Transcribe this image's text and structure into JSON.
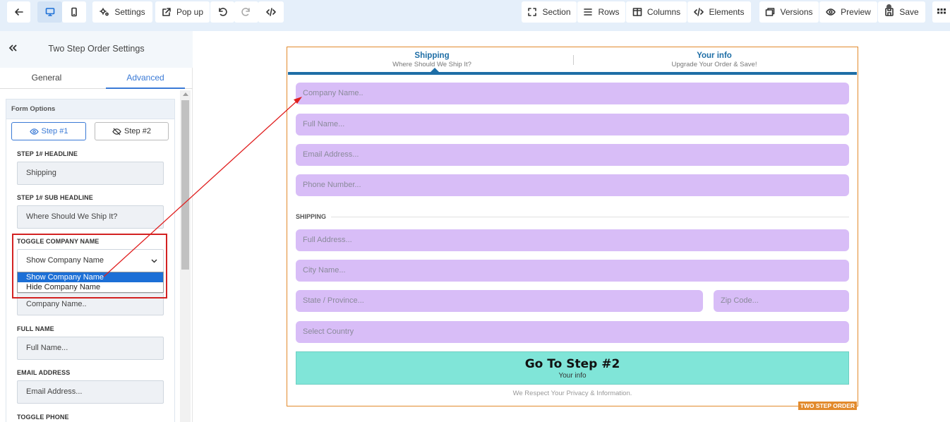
{
  "topbar": {
    "settings_label": "Settings",
    "popup_label": "Pop up",
    "section_label": "Section",
    "rows_label": "Rows",
    "columns_label": "Columns",
    "elements_label": "Elements",
    "versions_label": "Versions",
    "preview_label": "Preview",
    "save_label": "Save"
  },
  "sidebar": {
    "title": "Two Step Order Settings",
    "tabs": [
      "General",
      "Advanced"
    ],
    "active_tab": "Advanced",
    "panel_title": "Form Options",
    "step_buttons": [
      "Step #1",
      "Step #2"
    ],
    "fields": {
      "step1_headline_label": "STEP 1# HEADLINE",
      "step1_headline_value": "Shipping",
      "step1_sub_label": "STEP 1# SUB HEADLINE",
      "step1_sub_value": "Where Should We Ship It?",
      "toggle_company_label": "TOGGLE COMPANY NAME",
      "toggle_company_value": "Show Company Name",
      "toggle_company_options": [
        "Show Company Name",
        "Hide Company Name"
      ],
      "company_value": "Company Name..",
      "full_name_label": "FULL NAME",
      "full_name_value": "Full Name...",
      "email_label": "EMAIL ADDRESS",
      "email_value": "Email Address...",
      "toggle_phone_label": "TOGGLE PHONE"
    }
  },
  "form": {
    "tabs": [
      {
        "title": "Shipping",
        "subtitle": "Where Should We Ship It?"
      },
      {
        "title": "Your info",
        "subtitle": "Upgrade Your Order & Save!"
      }
    ],
    "placeholders": {
      "company": "Company Name..",
      "full_name": "Full Name...",
      "email": "Email Address...",
      "phone": "Phone Number...",
      "address": "Full Address...",
      "city": "City Name...",
      "state": "State / Province...",
      "zip": "Zip Code...",
      "country": "Select Country"
    },
    "section_label": "SHIPPING",
    "button_title": "Go To Step #2",
    "button_subtitle": "Your info",
    "privacy": "We Respect Your Privacy & Information.",
    "badge": "TWO STEP ORDER"
  },
  "colors": {
    "accent": "#3a7ad6",
    "form_tab": "#1e6ea6",
    "input_bg": "#d8bdf7",
    "button_bg": "#80e5d8",
    "border": "#e28a2c",
    "annotation": "#d32222"
  }
}
